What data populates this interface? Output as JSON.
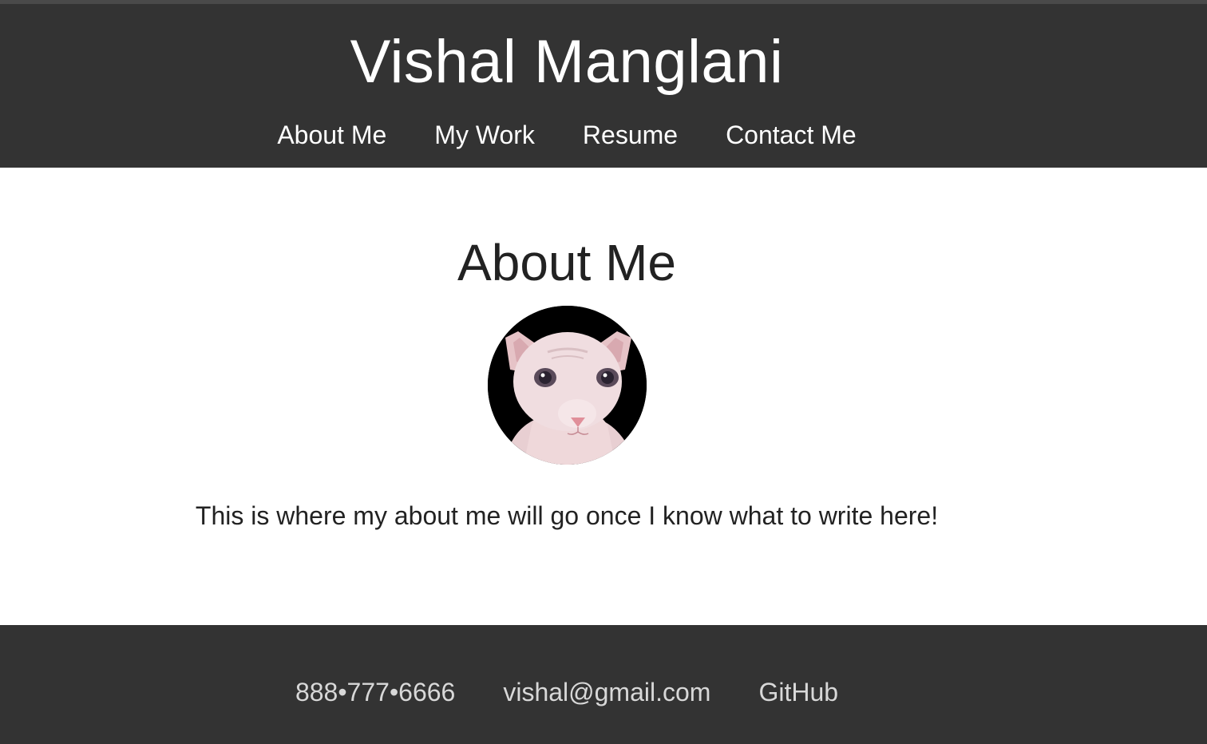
{
  "header": {
    "site_title": "Vishal Manglani",
    "nav": [
      {
        "label": "About Me"
      },
      {
        "label": "My Work"
      },
      {
        "label": "Resume"
      },
      {
        "label": "Contact Me"
      }
    ]
  },
  "main": {
    "section_title": "About Me",
    "avatar_icon": "hairless-cat-photo",
    "about_text": "This is where my about me will go once I know what to write here!"
  },
  "footer": {
    "phone": "888•777•6666",
    "email": "vishal@gmail.com",
    "github": "GitHub"
  },
  "colors": {
    "header_bg": "#333333",
    "footer_bg": "#333333",
    "text_dark": "#222222",
    "text_light": "#ffffff"
  }
}
